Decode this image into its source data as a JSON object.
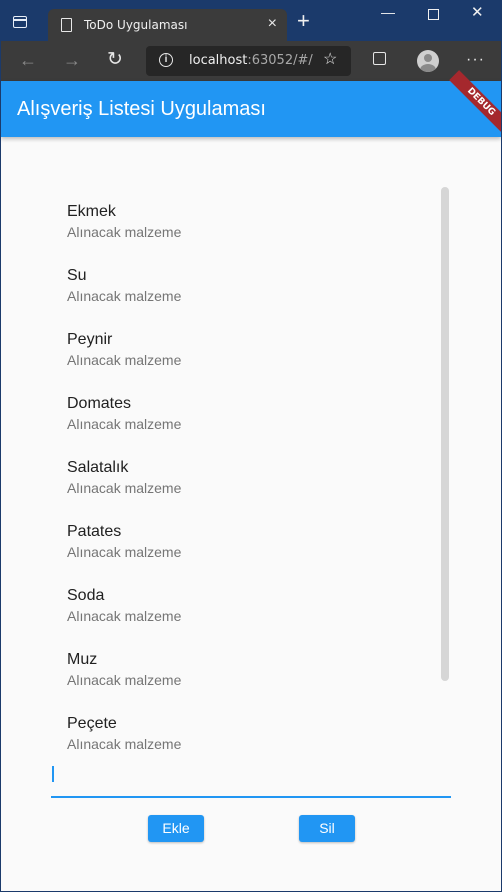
{
  "browser": {
    "tab_title": "ToDo Uygulaması",
    "tab_close": "×",
    "new_tab": "+",
    "url_host": "localhost",
    "url_rest": ":63052/#/"
  },
  "app": {
    "title": "Alışveriş Listesi Uygulaması",
    "debug_banner": "DEBUG"
  },
  "items": [
    {
      "title": "Ekmek",
      "subtitle": "Alınacak malzeme"
    },
    {
      "title": "Su",
      "subtitle": "Alınacak malzeme"
    },
    {
      "title": "Peynir",
      "subtitle": "Alınacak malzeme"
    },
    {
      "title": "Domates",
      "subtitle": "Alınacak malzeme"
    },
    {
      "title": "Salatalık",
      "subtitle": "Alınacak malzeme"
    },
    {
      "title": "Patates",
      "subtitle": "Alınacak malzeme"
    },
    {
      "title": "Soda",
      "subtitle": "Alınacak malzeme"
    },
    {
      "title": "Muz",
      "subtitle": "Alınacak malzeme"
    },
    {
      "title": "Peçete",
      "subtitle": "Alınacak malzeme"
    }
  ],
  "input": {
    "value": ""
  },
  "buttons": {
    "add": "Ekle",
    "delete": "Sil"
  },
  "colors": {
    "accent": "#2196f3",
    "debug": "#a5282d",
    "titlebar": "#1b3a6b"
  }
}
